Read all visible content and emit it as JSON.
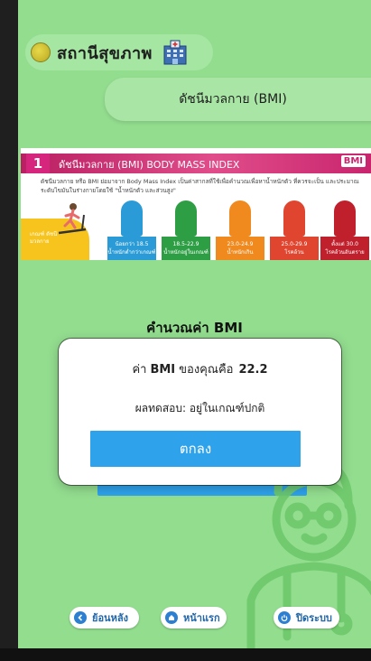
{
  "header": {
    "title": "สถานีสุขภาพ",
    "icon": "hospital-building-icon"
  },
  "subtitle": "ดัชนีมวลกาย (BMI)",
  "banner": {
    "number": "1",
    "title": "ดัชนีมวลกาย (BMI) BODY MASS INDEX",
    "badge": "BMI",
    "description": "ดัชนีมวลกาย หรือ BMI ย่อมาจาก Body Mass Index เป็นค่าสากลที่ใช้เพื่อคำนวณเพื่อหาน้ำหนักตัว ที่ควรจะเป็น และประมาณระดับไขมันในร่างกายโดยใช้ \"น้ำหนักตัว และส่วนสูง\"",
    "standard_label": "เกณฑ์ ดัชนีมวลกาย",
    "categories": [
      {
        "range": "น้อยกว่า 18.5",
        "label": "น้ำหนักต่ำกว่าเกณฑ์",
        "color": "#2a9bd6"
      },
      {
        "range": "18.5-22.9",
        "label": "น้ำหนักอยู่ในเกณฑ์",
        "color": "#2e9e45"
      },
      {
        "range": "23.0-24.9",
        "label": "น้ำหนักเกิน",
        "color": "#f08a1e"
      },
      {
        "range": "25.0-29.9",
        "label": "โรคอ้วน",
        "color": "#e0452f"
      },
      {
        "range": "ตั้งแต่ 30.0",
        "label": "โรคอ้วนอันตราย",
        "color": "#c01f2c"
      }
    ]
  },
  "calc_heading": "คำนวณค่า  BMI",
  "dialog": {
    "prefix": "ค่า",
    "bmi_label": "BMI",
    "middle": "ของคุณคือ",
    "bmi_value": "22.2",
    "result": "ผลทดสอบ: อยู่ในเกณฑ์ปกติ",
    "ok_label": "ตกลง"
  },
  "nav": {
    "back": "ย้อนหลัง",
    "home": "หน้าแรก",
    "close": "ปิดระบบ"
  },
  "colors": {
    "background": "#93dd8f",
    "accent": "#2ea2ea",
    "nav_text": "#2166a8"
  }
}
